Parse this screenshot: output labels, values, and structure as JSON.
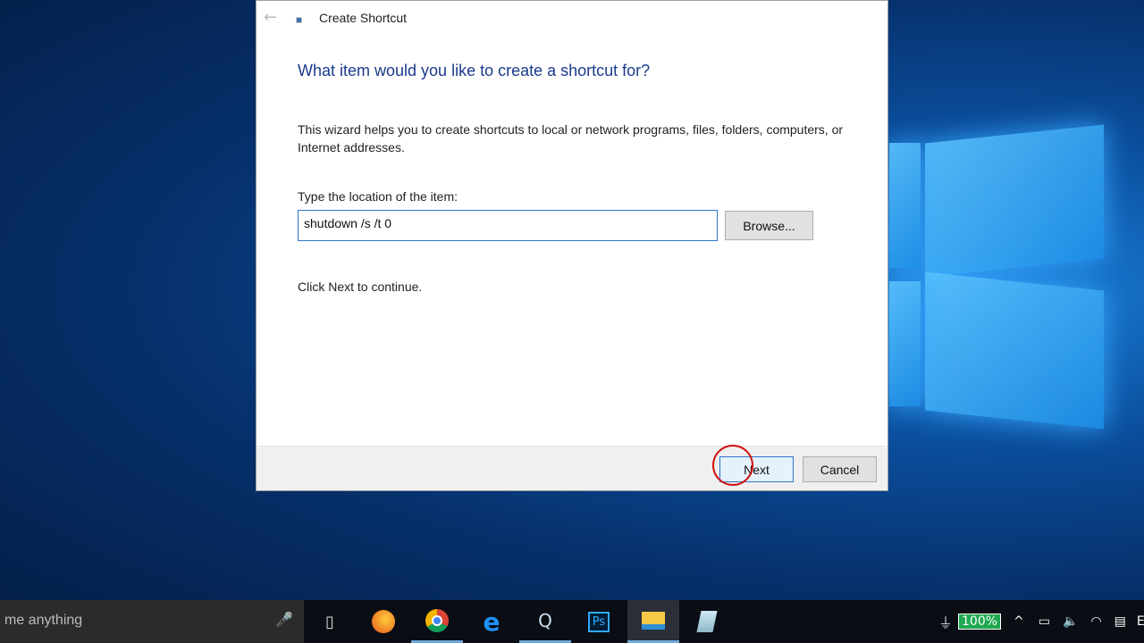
{
  "dialog": {
    "title": "Create Shortcut",
    "heading": "What item would you like to create a shortcut for?",
    "description": "This wizard helps you to create shortcuts to local or network programs, files, folders, computers, or Internet addresses.",
    "location_label": "Type the location of the item:",
    "location_value": "shutdown /s /t 0",
    "browse": "Browse...",
    "continue_text": "Click Next to continue.",
    "next": "Next",
    "cancel": "Cancel"
  },
  "taskbar": {
    "search_placeholder": "me anything",
    "battery": "100%",
    "clock_partial": "E"
  }
}
